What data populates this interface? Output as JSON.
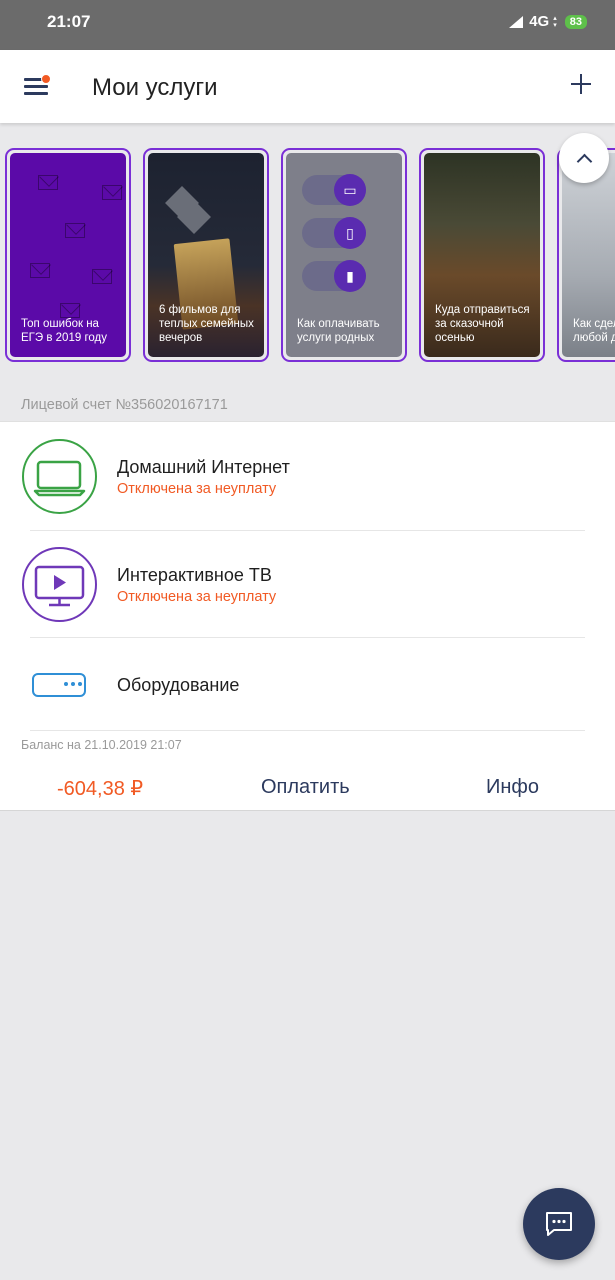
{
  "status_bar": {
    "time": "21:07",
    "network": "4G",
    "battery": "83"
  },
  "app_bar": {
    "title": "Мои услуги"
  },
  "stories": [
    {
      "caption": "Топ ошибок на ЕГЭ в 2019 году"
    },
    {
      "caption": "6 фильмов для теплых семейных вечеров"
    },
    {
      "caption": "Как оплачивать услуги родных"
    },
    {
      "caption": "Куда отправиться за сказочной осенью"
    },
    {
      "caption": "Как сделать любой дом умным"
    }
  ],
  "account": {
    "label": "Лицевой счет №356020167171"
  },
  "services": [
    {
      "name": "Домашний Интернет",
      "status": "Отключена за неуплату",
      "icon": "laptop-icon",
      "color": "#3aa345"
    },
    {
      "name": "Интерактивное ТВ",
      "status": "Отключена за неуплату",
      "icon": "tv-icon",
      "color": "#6f38b8"
    },
    {
      "name": "Оборудование",
      "status": "",
      "icon": "router-icon",
      "color": "#2f8fd6"
    }
  ],
  "balance": {
    "label": "Баланс на 21.10.2019 21:07",
    "amount": "-604,38 ₽",
    "pay_label": "Оплатить",
    "info_label": "Инфо"
  },
  "colors": {
    "accent": "#f15a24",
    "navy": "#2c3a5e",
    "story_border": "#7a2fd6"
  }
}
